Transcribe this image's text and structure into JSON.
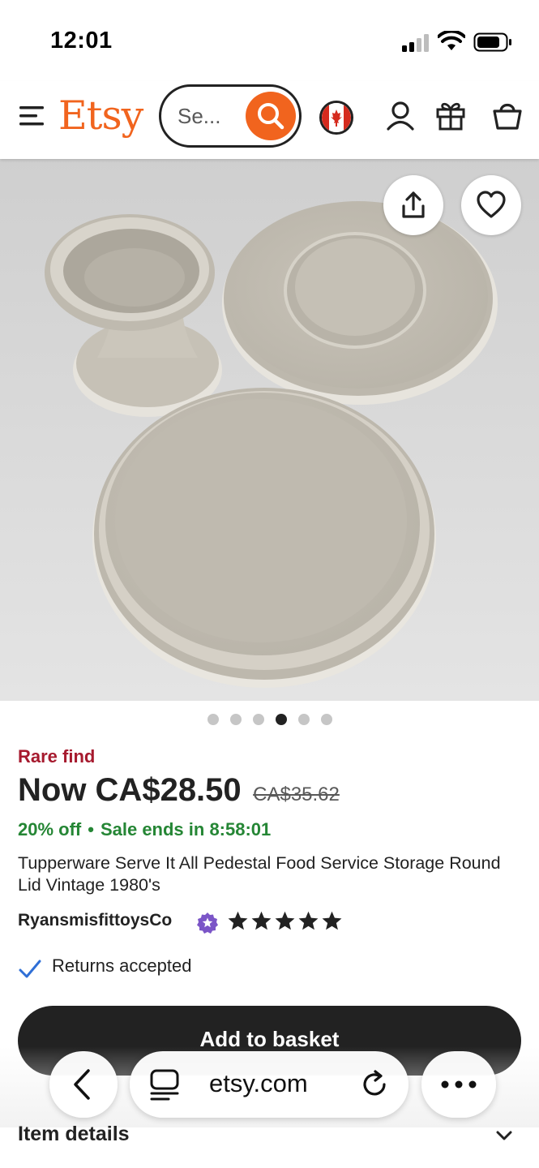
{
  "status_bar": {
    "time": "12:01"
  },
  "header": {
    "logo": "Etsy",
    "search_placeholder": "Se...",
    "icons": [
      "menu-icon",
      "search-icon",
      "canada-flag-icon",
      "account-icon",
      "gift-icon",
      "basket-icon"
    ]
  },
  "hero": {
    "image_alt": "Tupperware beige pedestal and round lids",
    "icons": [
      "share-icon",
      "heart-icon"
    ],
    "image_count": 6,
    "active_index": 3
  },
  "product": {
    "badge": "Rare find",
    "price_now": "Now CA$28.50",
    "price_original": "CA$35.62",
    "discount": "20% off",
    "sale_separator": "•",
    "sale_ends": "Sale ends in 8:58:01",
    "title": "Tupperware Serve It All Pedestal Food Service Storage Round Lid Vintage 1980's",
    "seller": "RyansmisfittoysCo",
    "rating_stars": 5,
    "returns": "Returns accepted",
    "add_to_basket": "Add to basket",
    "item_details": "Item details"
  },
  "browser": {
    "url": "etsy.com",
    "icons": [
      "back-icon",
      "tab-icon",
      "reload-icon",
      "more-icon"
    ]
  },
  "colors": {
    "brand_orange": "#f1641e",
    "rare_find": "#a61a2e",
    "sale_green": "#258635",
    "star_seller_purple": "#7b55c7",
    "dark": "#222222"
  }
}
